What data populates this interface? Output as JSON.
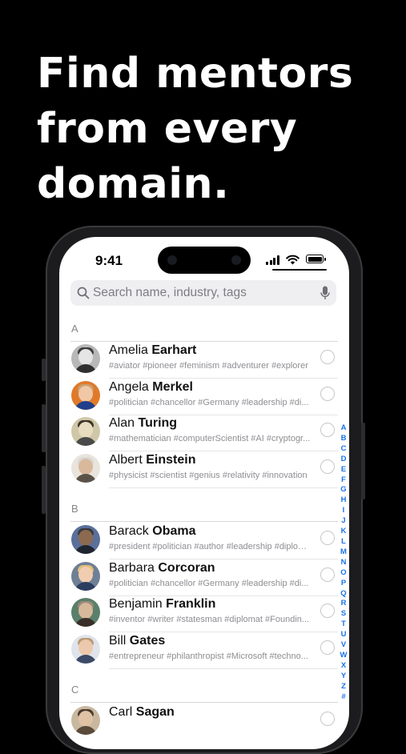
{
  "headline": [
    "Find mentors",
    "from every",
    "domain."
  ],
  "status_bar": {
    "time": "9:41"
  },
  "search": {
    "placeholder": "Search name, industry, tags"
  },
  "sections": [
    {
      "letter": "A",
      "contacts": [
        {
          "first": "Amelia",
          "last": "Earhart",
          "tags": "#aviator #pioneer #feminism #adventurer #explorer"
        },
        {
          "first": "Angela",
          "last": "Merkel",
          "tags": "#politician #chancellor #Germany #leadership #di..."
        },
        {
          "first": "Alan",
          "last": "Turing",
          "tags": "#mathematician #computerScientist #AI #cryptogr..."
        },
        {
          "first": "Albert",
          "last": "Einstein",
          "tags": "#physicist #scientist #genius #relativity #innovation"
        }
      ]
    },
    {
      "letter": "B",
      "contacts": [
        {
          "first": "Barack",
          "last": "Obama",
          "tags": "#president #politician #author #leadership #diplom..."
        },
        {
          "first": "Barbara",
          "last": "Corcoran",
          "tags": "#politician #chancellor #Germany #leadership #di..."
        },
        {
          "first": "Benjamin",
          "last": "Franklin",
          "tags": "#inventor #writer #statesman #diplomat #Foundin..."
        },
        {
          "first": "Bill",
          "last": "Gates",
          "tags": "#entrepreneur #philanthropist #Microsoft #techno..."
        }
      ]
    },
    {
      "letter": "C",
      "contacts": [
        {
          "first": "Carl",
          "last": "Sagan",
          "tags": ""
        }
      ]
    }
  ],
  "alphabet_index": [
    "A",
    "B",
    "C",
    "D",
    "E",
    "F",
    "G",
    "H",
    "I",
    "J",
    "K",
    "L",
    "M",
    "N",
    "O",
    "P",
    "Q",
    "R",
    "S",
    "T",
    "U",
    "V",
    "W",
    "X",
    "Y",
    "Z",
    "#"
  ],
  "colors": {
    "background": "#000000",
    "accent": "#1a73e8",
    "headline": "#ffffff"
  }
}
